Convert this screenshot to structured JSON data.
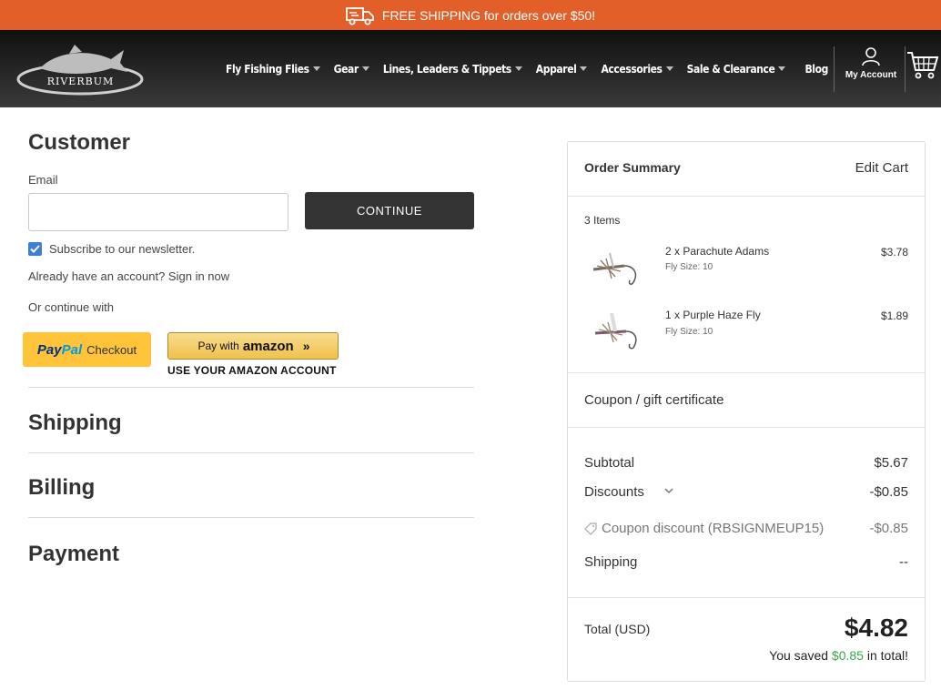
{
  "promo": {
    "text": "FREE SHIPPING for orders over $50!"
  },
  "header": {
    "logo_text": "RIVERBUM",
    "nav": [
      {
        "label": "Fly Fishing Flies",
        "has_dropdown": true
      },
      {
        "label": "Gear",
        "has_dropdown": true
      },
      {
        "label": "Lines, Leaders & Tippets",
        "has_dropdown": true
      },
      {
        "label": "Apparel",
        "has_dropdown": true
      },
      {
        "label": "Accessories",
        "has_dropdown": true
      },
      {
        "label": "Sale & Clearance",
        "has_dropdown": true
      },
      {
        "label": "Blog",
        "has_dropdown": false
      }
    ],
    "account_label": "My Account"
  },
  "customer": {
    "title": "Customer",
    "email_label": "Email",
    "email_value": "",
    "continue_label": "CONTINUE",
    "newsletter_label": "Subscribe to our newsletter.",
    "newsletter_checked": true,
    "signin_text": "Already have an account? Sign in now",
    "or_continue": "Or continue with",
    "paypal": {
      "part1": "Pay",
      "part2": "Pal",
      "part3": "Checkout"
    },
    "amazon": {
      "prefix": "Pay with",
      "brand": "amazon",
      "arrows": "»",
      "subtext": "USE YOUR AMAZON ACCOUNT"
    }
  },
  "sections": {
    "shipping": "Shipping",
    "billing": "Billing",
    "payment": "Payment"
  },
  "summary": {
    "title": "Order Summary",
    "edit_cart": "Edit Cart",
    "items_count": "3 Items",
    "items": [
      {
        "name": "2 x Parachute Adams",
        "option": "Fly Size: 10",
        "price": "$3.78"
      },
      {
        "name": "1 x Purple Haze Fly",
        "option": "Fly Size: 10",
        "price": "$1.89"
      }
    ],
    "coupon_label": "Coupon / gift certificate",
    "subtotal_label": "Subtotal",
    "subtotal_value": "$5.67",
    "discounts_label": "Discounts",
    "discounts_value": "-$0.85",
    "coupon_discount_label": "Coupon discount (RBSIGNMEUP15)",
    "coupon_discount_value": "-$0.85",
    "shipping_label": "Shipping",
    "shipping_value": "--",
    "total_label": "Total (USD)",
    "total_value": "$4.82",
    "saved_prefix": "You saved",
    "saved_amount": "$0.85",
    "saved_suffix": "in total!"
  },
  "colors": {
    "promo": "#e35f2a",
    "button_dark": "#333333",
    "checkbox": "#3c7fd4",
    "paypal": "#ffc439",
    "saved": "#3aa64a"
  }
}
